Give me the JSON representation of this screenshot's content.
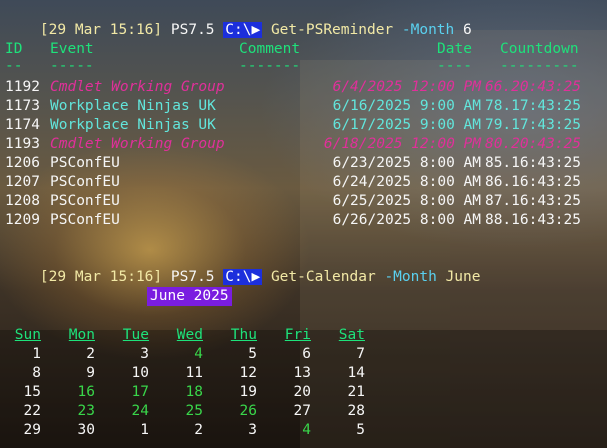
{
  "prompt1": {
    "timestamp": "[29 Mar 15:16]",
    "ps": "PS7.5",
    "path": "C:\\",
    "arrow": "▶",
    "command": "Get-PSReminder",
    "param": "-Month",
    "value": "6"
  },
  "table": {
    "headers": {
      "id": "ID",
      "event": "Event",
      "comment": "Comment",
      "date": "Date",
      "countdown": "Countdown"
    },
    "dashes": {
      "id": "--",
      "event": "-----",
      "comment": "-------",
      "date": "----",
      "countdown": "---------"
    },
    "rows": [
      {
        "id": "1192",
        "event": "Cmdlet Working Group",
        "date": "6/4/2025 12:00 PM",
        "countdown": "66.20:43:25",
        "style": "magenta"
      },
      {
        "id": "1173",
        "event": "Workplace Ninjas UK",
        "date": "6/16/2025 9:00 AM",
        "countdown": "78.17:43:25",
        "style": "teal"
      },
      {
        "id": "1174",
        "event": "Workplace Ninjas UK",
        "date": "6/17/2025 9:00 AM",
        "countdown": "79.17:43:25",
        "style": "teal"
      },
      {
        "id": "1193",
        "event": "Cmdlet Working Group",
        "date": "6/18/2025 12:00 PM",
        "countdown": "80.20:43:25",
        "style": "magenta"
      },
      {
        "id": "1206",
        "event": "PSConfEU",
        "date": "6/23/2025 8:00 AM",
        "countdown": "85.16:43:25",
        "style": "white"
      },
      {
        "id": "1207",
        "event": "PSConfEU",
        "date": "6/24/2025 8:00 AM",
        "countdown": "86.16:43:25",
        "style": "white"
      },
      {
        "id": "1208",
        "event": "PSConfEU",
        "date": "6/25/2025 8:00 AM",
        "countdown": "87.16:43:25",
        "style": "white"
      },
      {
        "id": "1209",
        "event": "PSConfEU",
        "date": "6/26/2025 8:00 AM",
        "countdown": "88.16:43:25",
        "style": "white"
      }
    ]
  },
  "prompt2": {
    "timestamp": "[29 Mar 15:16]",
    "ps": "PS7.5",
    "path": "C:\\",
    "arrow": "▶",
    "command": "Get-Calendar",
    "param": "-Month",
    "value": "June"
  },
  "calendar": {
    "title": "June 2025",
    "days": [
      "Sun",
      "Mon",
      "Tue",
      "Wed",
      "Thu",
      "Fri",
      "Sat"
    ],
    "weeks": [
      [
        {
          "d": "1"
        },
        {
          "d": "2"
        },
        {
          "d": "3"
        },
        {
          "d": "4",
          "hl": true
        },
        {
          "d": "5"
        },
        {
          "d": "6"
        },
        {
          "d": "7"
        }
      ],
      [
        {
          "d": "8"
        },
        {
          "d": "9"
        },
        {
          "d": "10"
        },
        {
          "d": "11"
        },
        {
          "d": "12"
        },
        {
          "d": "13"
        },
        {
          "d": "14"
        }
      ],
      [
        {
          "d": "15"
        },
        {
          "d": "16",
          "hl": true
        },
        {
          "d": "17",
          "hl": true
        },
        {
          "d": "18",
          "hl": true
        },
        {
          "d": "19"
        },
        {
          "d": "20"
        },
        {
          "d": "21"
        }
      ],
      [
        {
          "d": "22"
        },
        {
          "d": "23",
          "hl": true
        },
        {
          "d": "24",
          "hl": true
        },
        {
          "d": "25",
          "hl": true
        },
        {
          "d": "26",
          "hl": true
        },
        {
          "d": "27"
        },
        {
          "d": "28"
        }
      ],
      [
        {
          "d": "29"
        },
        {
          "d": "30"
        },
        {
          "d": "1"
        },
        {
          "d": "2"
        },
        {
          "d": "3"
        },
        {
          "d": "4",
          "hl": true
        },
        {
          "d": "5"
        }
      ]
    ]
  },
  "colors": {
    "prompt_text": "#f2e9a6",
    "path_badge": "#1c2fdc",
    "header_green": "#1ee27b",
    "magenta_row": "#e0309a",
    "teal_row": "#62e6dc",
    "calendar_title_bg": "#7a1de0",
    "highlight_day": "#39d64a"
  }
}
